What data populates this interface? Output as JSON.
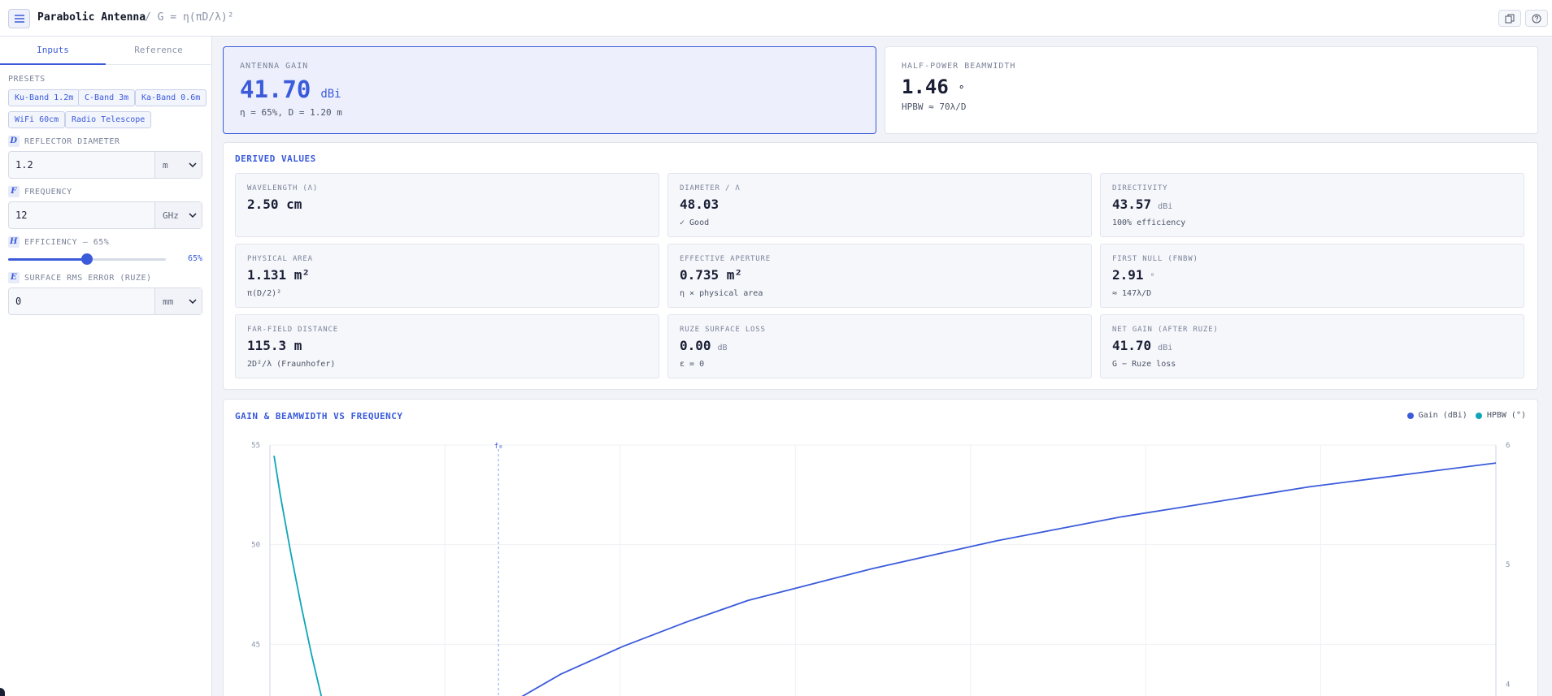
{
  "app": {
    "title": "Parabolic Antenna",
    "formula": "/ G = η(πD/λ)²",
    "toolbar_icons": [
      "copy-icon",
      "help-icon"
    ]
  },
  "sidebar": {
    "tabs": [
      {
        "label": "Inputs",
        "active": true
      },
      {
        "label": "Reference",
        "active": false
      }
    ],
    "presets_label": "PRESETS",
    "presets": [
      "Ku-Band 1.2m",
      "C-Band 3m",
      "Ka-Band 0.6m",
      "WiFi 60cm",
      "Radio Telescope"
    ],
    "diameter": {
      "symbol": "D",
      "label": "REFLECTOR DIAMETER",
      "value": "1.2",
      "unit": "m"
    },
    "frequency": {
      "symbol": "F",
      "label": "FREQUENCY",
      "value": "12",
      "unit": "GHz"
    },
    "efficiency": {
      "symbol": "H",
      "label": "EFFICIENCY — 65%",
      "value_label": "65%",
      "value": 0.65
    },
    "surface": {
      "symbol": "E",
      "label": "SURFACE RMS ERROR (RUZE)",
      "value": "0",
      "unit": "mm"
    }
  },
  "hero": {
    "gain": {
      "label": "ANTENNA GAIN",
      "value": "41.70",
      "unit": "dBi",
      "sub": "η = 65%, D = 1.20 m"
    },
    "hpbw": {
      "label": "HALF-POWER BEAMWIDTH",
      "value": "1.46",
      "unit": "°",
      "sub": "HPBW ≈ 70λ/D"
    }
  },
  "derived": {
    "title": "DERIVED VALUES",
    "metrics": [
      {
        "label": "WAVELENGTH (Λ)",
        "value": "2.50 cm",
        "unit": "",
        "sub": ""
      },
      {
        "label": "DIAMETER / Λ",
        "value": "48.03",
        "unit": "",
        "sub": "✓ Good"
      },
      {
        "label": "DIRECTIVITY",
        "value": "43.57",
        "unit": "dBi",
        "sub": "100% efficiency"
      },
      {
        "label": "PHYSICAL AREA",
        "value": "1.131 m²",
        "unit": "",
        "sub": "π(D/2)²"
      },
      {
        "label": "EFFECTIVE APERTURE",
        "value": "0.735 m²",
        "unit": "",
        "sub": "η × physical area"
      },
      {
        "label": "FIRST NULL (FNBW)",
        "value": "2.91",
        "unit": "°",
        "sub": "≈ 147λ/D"
      },
      {
        "label": "FAR-FIELD DISTANCE",
        "value": "115.3 m",
        "unit": "",
        "sub": "2D²/λ (Fraunhofer)"
      },
      {
        "label": "RUZE SURFACE LOSS",
        "value": "0.00",
        "unit": "dB",
        "sub": "ε = 0"
      },
      {
        "label": "NET GAIN (AFTER RUZE)",
        "value": "41.70",
        "unit": "dBi",
        "sub": "G − Ruze loss"
      }
    ]
  },
  "chart": {
    "title": "GAIN & BEAMWIDTH VS FREQUENCY",
    "marker_label": "f₀",
    "colors": {
      "gain": "#3b5bdb",
      "hpbw": "#0fa5b8"
    }
  },
  "chart_data": {
    "type": "line",
    "title": "GAIN & BEAMWIDTH VS FREQUENCY",
    "y_left": {
      "ticks": [
        55,
        50,
        45
      ],
      "range": [
        40,
        55
      ]
    },
    "y_right": {
      "ticks": [
        6,
        5,
        4
      ],
      "range": [
        3.5,
        6
      ]
    },
    "x_range": [
      1,
      60
    ],
    "marker_x": 12,
    "series": [
      {
        "name": "Gain (dBi)",
        "axis": "left",
        "x": [
          12,
          15,
          18,
          21,
          24,
          27,
          30,
          33,
          36,
          39,
          42,
          45,
          48,
          51,
          54,
          57,
          60
        ],
        "values": [
          41.7,
          43.5,
          44.9,
          46.1,
          47.2,
          48.0,
          48.8,
          49.5,
          50.2,
          50.8,
          51.4,
          51.9,
          52.4,
          52.9,
          53.3,
          53.7,
          54.1
        ]
      },
      {
        "name": "HPBW (°)",
        "axis": "right",
        "x": [
          1.2,
          1.5,
          2.0,
          2.5,
          3.0,
          3.5
        ],
        "values": [
          5.91,
          5.58,
          5.1,
          4.66,
          4.25,
          3.88
        ]
      }
    ]
  }
}
